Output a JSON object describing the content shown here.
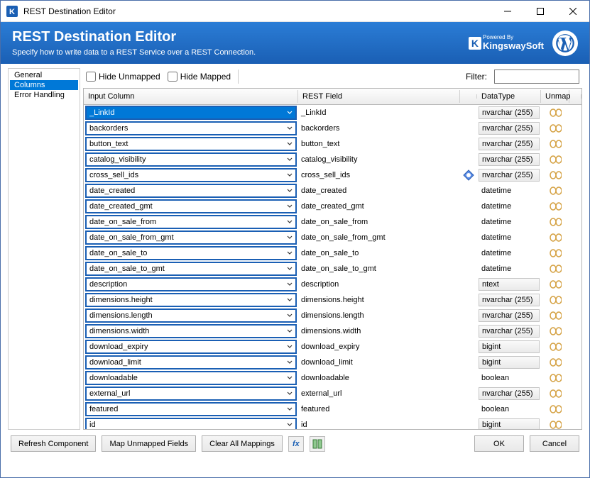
{
  "window": {
    "title": "REST Destination Editor"
  },
  "header": {
    "title": "REST Destination Editor",
    "subtitle": "Specify how to write data to a REST Service over a REST Connection.",
    "powered_by": "Powered By",
    "brand": "KingswaySoft"
  },
  "sidebar": {
    "items": [
      {
        "label": "General",
        "selected": false
      },
      {
        "label": "Columns",
        "selected": true
      },
      {
        "label": "Error Handling",
        "selected": false
      }
    ]
  },
  "toolbar": {
    "hide_unmapped": "Hide Unmapped",
    "hide_mapped": "Hide Mapped",
    "filter_label": "Filter:",
    "filter_value": ""
  },
  "grid": {
    "headers": {
      "input": "Input Column",
      "rest": "REST Field",
      "type": "DataType",
      "unmap": "Unmap"
    },
    "rows": [
      {
        "input": "_LinkId",
        "rest": "_LinkId",
        "type": "nvarchar (255)",
        "type_boxed": true,
        "selected": true,
        "key": false
      },
      {
        "input": "backorders",
        "rest": "backorders",
        "type": "nvarchar (255)",
        "type_boxed": true,
        "selected": false,
        "key": false
      },
      {
        "input": "button_text",
        "rest": "button_text",
        "type": "nvarchar (255)",
        "type_boxed": true,
        "selected": false,
        "key": false
      },
      {
        "input": "catalog_visibility",
        "rest": "catalog_visibility",
        "type": "nvarchar (255)",
        "type_boxed": true,
        "selected": false,
        "key": false
      },
      {
        "input": "cross_sell_ids",
        "rest": "cross_sell_ids",
        "type": "nvarchar (255)",
        "type_boxed": true,
        "selected": false,
        "key": true
      },
      {
        "input": "date_created",
        "rest": "date_created",
        "type": "datetime",
        "type_boxed": false,
        "selected": false,
        "key": false
      },
      {
        "input": "date_created_gmt",
        "rest": "date_created_gmt",
        "type": "datetime",
        "type_boxed": false,
        "selected": false,
        "key": false
      },
      {
        "input": "date_on_sale_from",
        "rest": "date_on_sale_from",
        "type": "datetime",
        "type_boxed": false,
        "selected": false,
        "key": false
      },
      {
        "input": "date_on_sale_from_gmt",
        "rest": "date_on_sale_from_gmt",
        "type": "datetime",
        "type_boxed": false,
        "selected": false,
        "key": false
      },
      {
        "input": "date_on_sale_to",
        "rest": "date_on_sale_to",
        "type": "datetime",
        "type_boxed": false,
        "selected": false,
        "key": false
      },
      {
        "input": "date_on_sale_to_gmt",
        "rest": "date_on_sale_to_gmt",
        "type": "datetime",
        "type_boxed": false,
        "selected": false,
        "key": false
      },
      {
        "input": "description",
        "rest": "description",
        "type": "ntext",
        "type_boxed": true,
        "selected": false,
        "key": false
      },
      {
        "input": "dimensions.height",
        "rest": "dimensions.height",
        "type": "nvarchar (255)",
        "type_boxed": true,
        "selected": false,
        "key": false
      },
      {
        "input": "dimensions.length",
        "rest": "dimensions.length",
        "type": "nvarchar (255)",
        "type_boxed": true,
        "selected": false,
        "key": false
      },
      {
        "input": "dimensions.width",
        "rest": "dimensions.width",
        "type": "nvarchar (255)",
        "type_boxed": true,
        "selected": false,
        "key": false
      },
      {
        "input": "download_expiry",
        "rest": "download_expiry",
        "type": "bigint",
        "type_boxed": true,
        "selected": false,
        "key": false
      },
      {
        "input": "download_limit",
        "rest": "download_limit",
        "type": "bigint",
        "type_boxed": true,
        "selected": false,
        "key": false
      },
      {
        "input": "downloadable",
        "rest": "downloadable",
        "type": "boolean",
        "type_boxed": false,
        "selected": false,
        "key": false
      },
      {
        "input": "external_url",
        "rest": "external_url",
        "type": "nvarchar (255)",
        "type_boxed": true,
        "selected": false,
        "key": false
      },
      {
        "input": "featured",
        "rest": "featured",
        "type": "boolean",
        "type_boxed": false,
        "selected": false,
        "key": false
      },
      {
        "input": "id",
        "rest": "id",
        "type": "bigint",
        "type_boxed": true,
        "selected": false,
        "key": false
      }
    ]
  },
  "footer": {
    "refresh": "Refresh Component",
    "map_unmapped": "Map Unmapped Fields",
    "clear_all": "Clear All Mappings",
    "ok": "OK",
    "cancel": "Cancel"
  }
}
